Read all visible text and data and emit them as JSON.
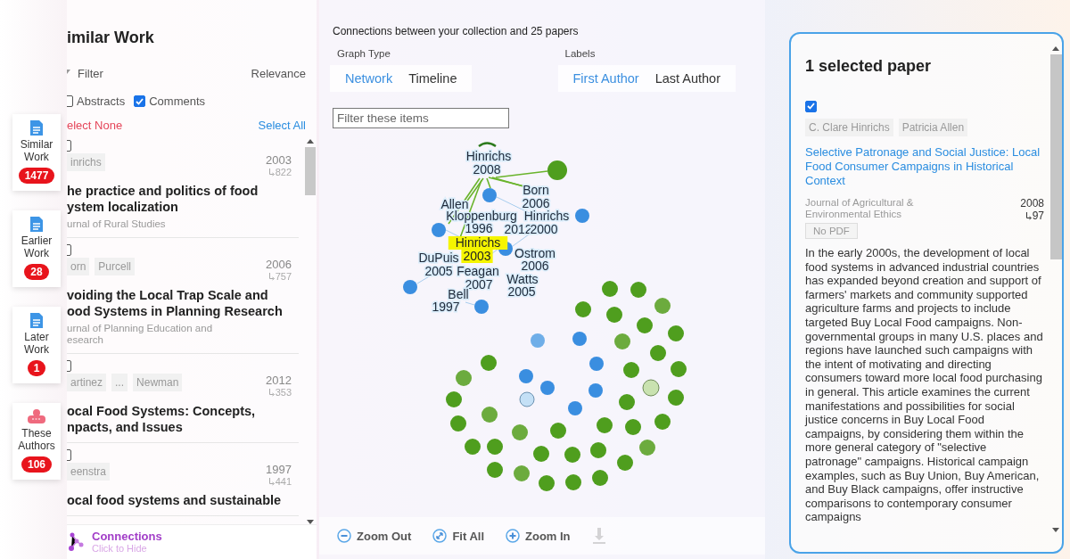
{
  "side_nav": [
    {
      "label_lines": [
        "Similar",
        "Work"
      ],
      "count": "1477",
      "kind": "document"
    },
    {
      "label_lines": [
        "Earlier",
        "Work"
      ],
      "count": "28",
      "kind": "document"
    },
    {
      "label_lines": [
        "Later",
        "Work"
      ],
      "count": "1",
      "kind": "document"
    },
    {
      "label_lines": [
        "These",
        "Authors"
      ],
      "count": "106",
      "kind": "people"
    }
  ],
  "list_panel": {
    "title": "imilar Work",
    "filter": "Filter",
    "sort": "Relevance",
    "toggles": [
      {
        "label": "Abstracts",
        "checked": false
      },
      {
        "label": "Comments",
        "checked": true
      }
    ],
    "select_none": "elect None",
    "select_all": "Select All",
    "papers": [
      {
        "checked": false,
        "authors": [
          "inrichs"
        ],
        "year": "2003",
        "cites": "822",
        "title_lines": [
          "he practice and politics of food",
          "ystem localization"
        ],
        "journal_lines": [
          "urnal of Rural Studies"
        ]
      },
      {
        "checked": false,
        "authors": [
          "orn",
          "Purcell"
        ],
        "year": "2006",
        "cites": "757",
        "title_lines": [
          "voiding the Local Trap Scale and",
          "ood Systems in Planning Research"
        ],
        "journal_lines": [
          "urnal of Planning Education and",
          "esearch"
        ]
      },
      {
        "checked": false,
        "authors": [
          "artinez",
          "...",
          "Newman"
        ],
        "year": "2012",
        "cites": "353",
        "title_lines": [
          "ocal Food Systems: Concepts,",
          "npacts, and Issues"
        ]
      },
      {
        "checked": false,
        "authors": [
          "eenstra"
        ],
        "year": "1997",
        "cites": "441",
        "title_lines": [
          "ocal food systems and sustainable"
        ]
      }
    ],
    "connections": {
      "label": "Connections",
      "hint": "Click to Hide"
    }
  },
  "graph_panel": {
    "heading": "Connections between your collection and 25 papers",
    "graph_type": {
      "label": "Graph Type",
      "options": [
        {
          "label": "Network",
          "selected": true
        },
        {
          "label": "Timeline",
          "selected": false
        }
      ]
    },
    "labels": {
      "label": "Labels",
      "options": [
        {
          "label": "First Author",
          "selected": true
        },
        {
          "label": "Last Author",
          "selected": false
        }
      ]
    },
    "filter": {
      "placeholder": "Filter these items"
    },
    "node_labels": [
      {
        "text": "Hinrichs",
        "highlighted": false
      },
      {
        "text": "2008",
        "highlighted": false
      },
      {
        "text": "Born",
        "highlighted": false
      },
      {
        "text": "2006",
        "highlighted": false
      },
      {
        "text": "Allen",
        "highlighted": false
      },
      {
        "text": "Kloppenburg",
        "highlighted": false
      },
      {
        "text": "Hinrichs",
        "highlighted": false
      },
      {
        "text": "1996",
        "highlighted": false
      },
      {
        "text": "2012",
        "highlighted": false
      },
      {
        "text": "2000",
        "highlighted": false
      },
      {
        "text": "Hinrichs",
        "highlighted": true
      },
      {
        "text": "2003",
        "highlighted": true
      },
      {
        "text": "Ostrom",
        "highlighted": false
      },
      {
        "text": "DuPuis",
        "highlighted": false
      },
      {
        "text": "2006",
        "highlighted": false
      },
      {
        "text": "2005",
        "highlighted": false
      },
      {
        "text": "Feagan",
        "highlighted": false
      },
      {
        "text": "Watts",
        "highlighted": false
      },
      {
        "text": "2007",
        "highlighted": false
      },
      {
        "text": "Bell",
        "highlighted": false
      },
      {
        "text": "2005",
        "highlighted": false
      },
      {
        "text": "1997",
        "highlighted": false
      }
    ],
    "toolbar": [
      {
        "kind": "zoom-out",
        "label": "Zoom Out",
        "disabled": false
      },
      {
        "kind": "fit",
        "label": "Fit All",
        "disabled": false
      },
      {
        "kind": "zoom-in",
        "label": "Zoom In",
        "disabled": false
      },
      {
        "kind": "download",
        "disabled": true
      }
    ]
  },
  "selected_panel": {
    "title": "1 selected paper",
    "checked": true,
    "authors": [
      "C. Clare Hinrichs",
      "Patricia Allen"
    ],
    "paper_title": "Selective Patronage and Social Justice: Local Food Consumer Campaigns in Historical Context",
    "journal": "Journal of Agricultural & Environmental Ethics",
    "year": "2008",
    "cites": "97",
    "pdf": "No PDF",
    "abstract": "In the early 2000s, the development of local food systems in advanced industrial countries has expanded beyond creation and support of farmers' markets and community supported agriculture farms and projects to include targeted Buy Local Food campaigns. Non-governmental groups in many U.S. places and regions have launched such campaigns with the intent of motivating and directing consumers toward more local food purchasing in general. This article examines the current manifestations and possibilities for social justice concerns in Buy Local Food campaigns, by considering them within the more general category of \"selective patronage\" campaigns. Historical campaign examples, such as Buy Union, Buy American, and Buy Black campaigns, offer instructive comparisons to contemporary consumer campaigns"
  }
}
